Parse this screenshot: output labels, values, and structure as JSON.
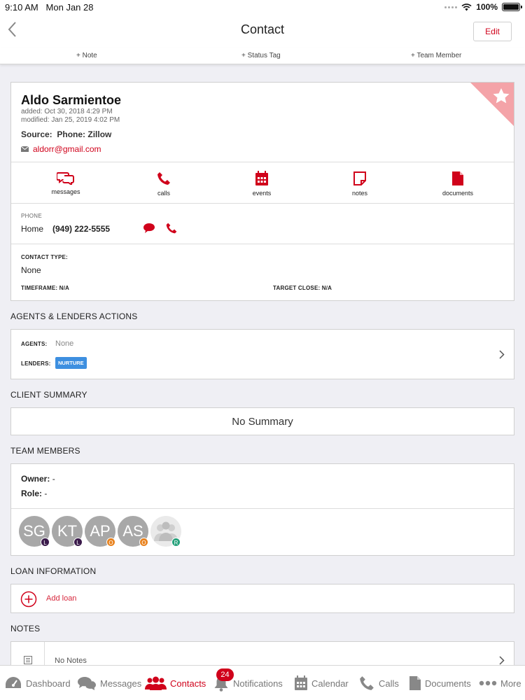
{
  "status_bar": {
    "time": "9:10 AM",
    "date": "Mon Jan 28",
    "battery": "100%",
    "battery_level": 1.0
  },
  "nav": {
    "title": "Contact",
    "edit_label": "Edit"
  },
  "action_bar": {
    "note": "+ Note",
    "status_tag": "+ Status Tag",
    "team_member": "+ Team Member"
  },
  "contact": {
    "name": "Aldo Sarmientoe",
    "added": "added: Oct 30, 2018 4:29 PM",
    "modified": "modified: Jan 25, 2019 4:02 PM",
    "source_label": "Source:",
    "source_value": "Phone: Zillow",
    "email": "aldorr@gmail.com",
    "favorite": true
  },
  "quick_actions": [
    {
      "label": "messages",
      "icon": "chat-icon"
    },
    {
      "label": "calls",
      "icon": "phone-icon"
    },
    {
      "label": "events",
      "icon": "calendar-icon"
    },
    {
      "label": "notes",
      "icon": "note-icon"
    },
    {
      "label": "documents",
      "icon": "document-icon"
    }
  ],
  "phone": {
    "header": "PHONE",
    "type": "Home",
    "number": "(949) 222-5555"
  },
  "contact_type": {
    "header": "CONTACT TYPE:",
    "value": "None",
    "timeframe": "TIMEFRAME: N/A",
    "target_close": "TARGET CLOSE: N/A"
  },
  "agents_lenders": {
    "header": "AGENTS & LENDERS ACTIONS",
    "agents_label": "AGENTS:",
    "agents_value": "None",
    "lenders_label": "LENDERS:",
    "lenders_tag": "NURTURE"
  },
  "client_summary": {
    "header": "CLIENT SUMMARY",
    "value": "No Summary"
  },
  "team_members": {
    "header": "TEAM MEMBERS",
    "owner_label": "Owner:",
    "owner_value": "-",
    "role_label": "Role:",
    "role_value": "-",
    "members": [
      {
        "initials": "SG",
        "badge": "L",
        "badge_color": "#3a1a4a"
      },
      {
        "initials": "KT",
        "badge": "L",
        "badge_color": "#3a1a4a"
      },
      {
        "initials": "AP",
        "badge": "O",
        "badge_color": "#e8821e"
      },
      {
        "initials": "AS",
        "badge": "O",
        "badge_color": "#e8821e"
      },
      {
        "initials": "",
        "badge": "R",
        "badge_color": "#26a17b"
      }
    ]
  },
  "loan": {
    "header": "LOAN INFORMATION",
    "add_label": "Add loan"
  },
  "notes": {
    "header": "NOTES",
    "value": "No Notes"
  },
  "tab_bar": {
    "tabs": [
      {
        "label": "Dashboard",
        "icon": "dashboard-icon"
      },
      {
        "label": "Messages",
        "icon": "messages-icon"
      },
      {
        "label": "Contacts",
        "icon": "contacts-icon",
        "active": true
      },
      {
        "label": "Notifications",
        "icon": "bell-icon",
        "badge": "24"
      },
      {
        "label": "Calendar",
        "icon": "calendar-icon"
      },
      {
        "label": "Calls",
        "icon": "phone-icon"
      },
      {
        "label": "Documents",
        "icon": "document-icon"
      },
      {
        "label": "More",
        "icon": "more-icon"
      }
    ]
  },
  "colors": {
    "accent": "#d0021b",
    "tag_blue": "#3d8fe0",
    "favorite_corner": "#f4a3a8"
  }
}
